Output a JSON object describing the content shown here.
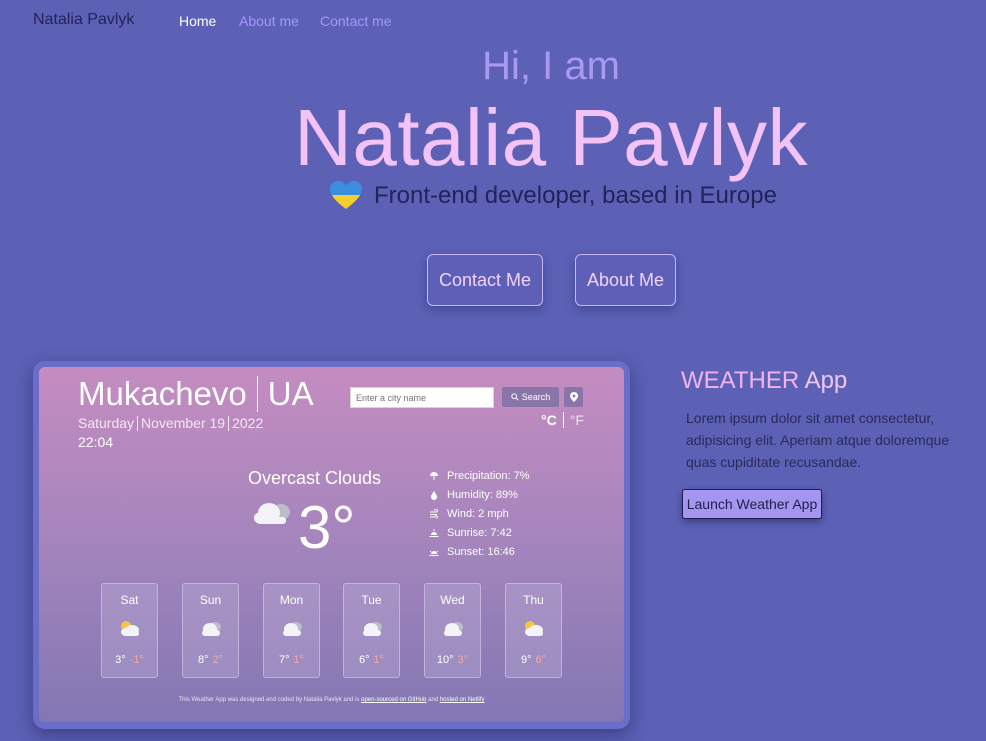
{
  "nav": {
    "brand": "Natalia Pavlyk",
    "links": [
      "Home",
      "About me",
      "Contact me"
    ]
  },
  "hero": {
    "greeting": "Hi, I am",
    "name": "Natalia Pavlyk",
    "tagline": "Front-end developer, based in Europe",
    "tagline_icon": "ukraine-heart-icon",
    "buttons": [
      "Contact Me",
      "About Me"
    ]
  },
  "weather_widget": {
    "city": "Mukachevo",
    "country": "UA",
    "day": "Saturday",
    "date": "November 19",
    "year": "2022",
    "time": "22:04",
    "search_placeholder": "Enter a city name",
    "search_label": "Search",
    "unit_c": "°C",
    "unit_f": "°F",
    "description": "Overcast Clouds",
    "temperature": "3°",
    "details": [
      {
        "icon": "umbrella-icon",
        "text": "Precipitation: 7%"
      },
      {
        "icon": "drop-icon",
        "text": "Humidity: 89%"
      },
      {
        "icon": "wind-icon",
        "text": "Wind: 2 mph"
      },
      {
        "icon": "sunrise-icon",
        "text": "Sunrise: 7:42"
      },
      {
        "icon": "sunset-icon",
        "text": "Sunset: 16:46"
      }
    ],
    "forecast": [
      {
        "day": "Sat",
        "icon": "sun-cloud-icon",
        "hi": "3°",
        "lo": "-1°"
      },
      {
        "day": "Sun",
        "icon": "cloud-icon",
        "hi": "8°",
        "lo": "2°"
      },
      {
        "day": "Mon",
        "icon": "cloud-icon",
        "hi": "7°",
        "lo": "1°"
      },
      {
        "day": "Tue",
        "icon": "cloud-icon",
        "hi": "6°",
        "lo": "1°"
      },
      {
        "day": "Wed",
        "icon": "cloud-icon",
        "hi": "10°",
        "lo": "3°"
      },
      {
        "day": "Thu",
        "icon": "sun-cloud-icon",
        "hi": "9°",
        "lo": "6°"
      }
    ],
    "credits_prefix": "This Weather App was designed and coded by Natalia Pavlyk and is ",
    "credits_link1": "open-sourced on GitHub",
    "credits_mid": " and ",
    "credits_link2": "hosted on Netlify"
  },
  "project": {
    "title_main": "WEATHER",
    "title_suffix": " App",
    "description": "Lorem ipsum dolor sit amet consectetur, adipisicing elit. Aperiam atque doloremque quas cupiditate recusandae.",
    "button": "Launch Weather App"
  },
  "colors": {
    "background": "#5c61b6",
    "accent_pink": "#f3c2f6",
    "accent_violet": "#a596ff"
  }
}
